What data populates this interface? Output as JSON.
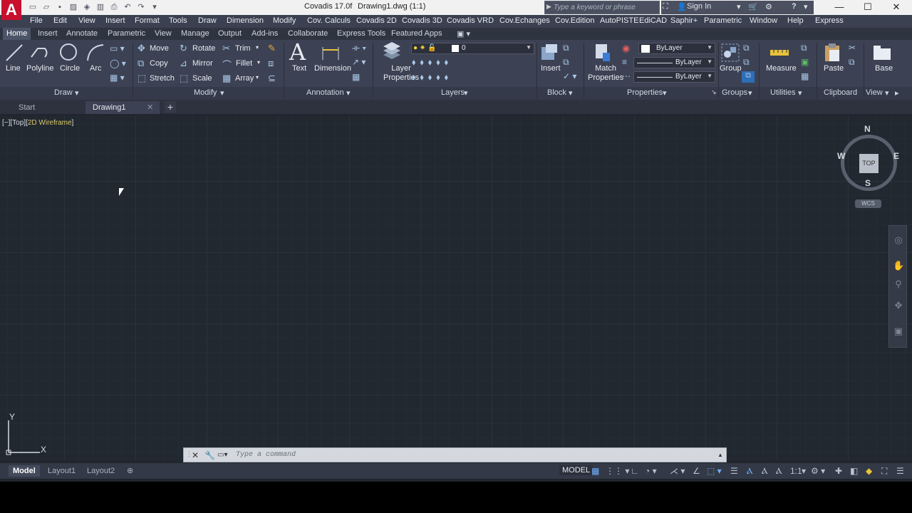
{
  "titlebar": {
    "logo": "A",
    "app_title": "Covadis 17.0f",
    "doc_title": "Drawing1.dwg (1:1)",
    "search_placeholder": "Type a keyword or phrase",
    "sign_in": "Sign In",
    "help": "?"
  },
  "menu": [
    "File",
    "Edit",
    "View",
    "Insert",
    "Format",
    "Tools",
    "Draw",
    "Dimension",
    "Modify",
    "Cov. Calculs",
    "Covadis 2D",
    "Covadis 3D",
    "Covadis VRD",
    "Cov.Echanges",
    "Cov.Edition",
    "AutoPISTE",
    "EdiCAD",
    "Saphir+",
    "Parametric",
    "Window",
    "Help",
    "Express"
  ],
  "ribbon_tabs": [
    "Home",
    "Insert",
    "Annotate",
    "Parametric",
    "View",
    "Manage",
    "Output",
    "Add-ins",
    "Collaborate",
    "Express Tools",
    "Featured Apps"
  ],
  "draw": {
    "line": "Line",
    "polyline": "Polyline",
    "circle": "Circle",
    "arc": "Arc",
    "panel": "Draw"
  },
  "modify": {
    "move": "Move",
    "rotate": "Rotate",
    "trim": "Trim",
    "copy": "Copy",
    "mirror": "Mirror",
    "fillet": "Fillet",
    "stretch": "Stretch",
    "scale": "Scale",
    "array": "Array",
    "panel": "Modify"
  },
  "annotation": {
    "text": "Text",
    "dimension": "Dimension",
    "panel": "Annotation"
  },
  "layers": {
    "layer_properties": "Layer\nProperties",
    "current_layer": "0",
    "panel": "Layers"
  },
  "block": {
    "insert": "Insert",
    "panel": "Block"
  },
  "properties": {
    "match": "Match\nProperties",
    "color": "ByLayer",
    "linetype": "ByLayer",
    "lineweight": "ByLayer",
    "panel": "Properties"
  },
  "groups": {
    "group": "Group",
    "panel": "Groups"
  },
  "utilities": {
    "measure": "Measure",
    "panel": "Utilities"
  },
  "clipboard": {
    "paste": "Paste",
    "panel": "Clipboard"
  },
  "view": {
    "base": "Base",
    "panel": "View"
  },
  "doc_tabs": {
    "start": "Start",
    "drawing": "Drawing1"
  },
  "viewport": {
    "controls": "[−][Top][",
    "style": "2D Wireframe",
    "close": "]"
  },
  "viewcube": {
    "n": "N",
    "s": "S",
    "e": "E",
    "w": "W",
    "top": "TOP",
    "wcs": "WCS"
  },
  "ucs": {
    "x": "X",
    "y": "Y"
  },
  "command": {
    "placeholder": "Type a command"
  },
  "layout_tabs": [
    "Model",
    "Layout1",
    "Layout2"
  ],
  "status": {
    "model": "MODEL",
    "scale": "1:1"
  }
}
